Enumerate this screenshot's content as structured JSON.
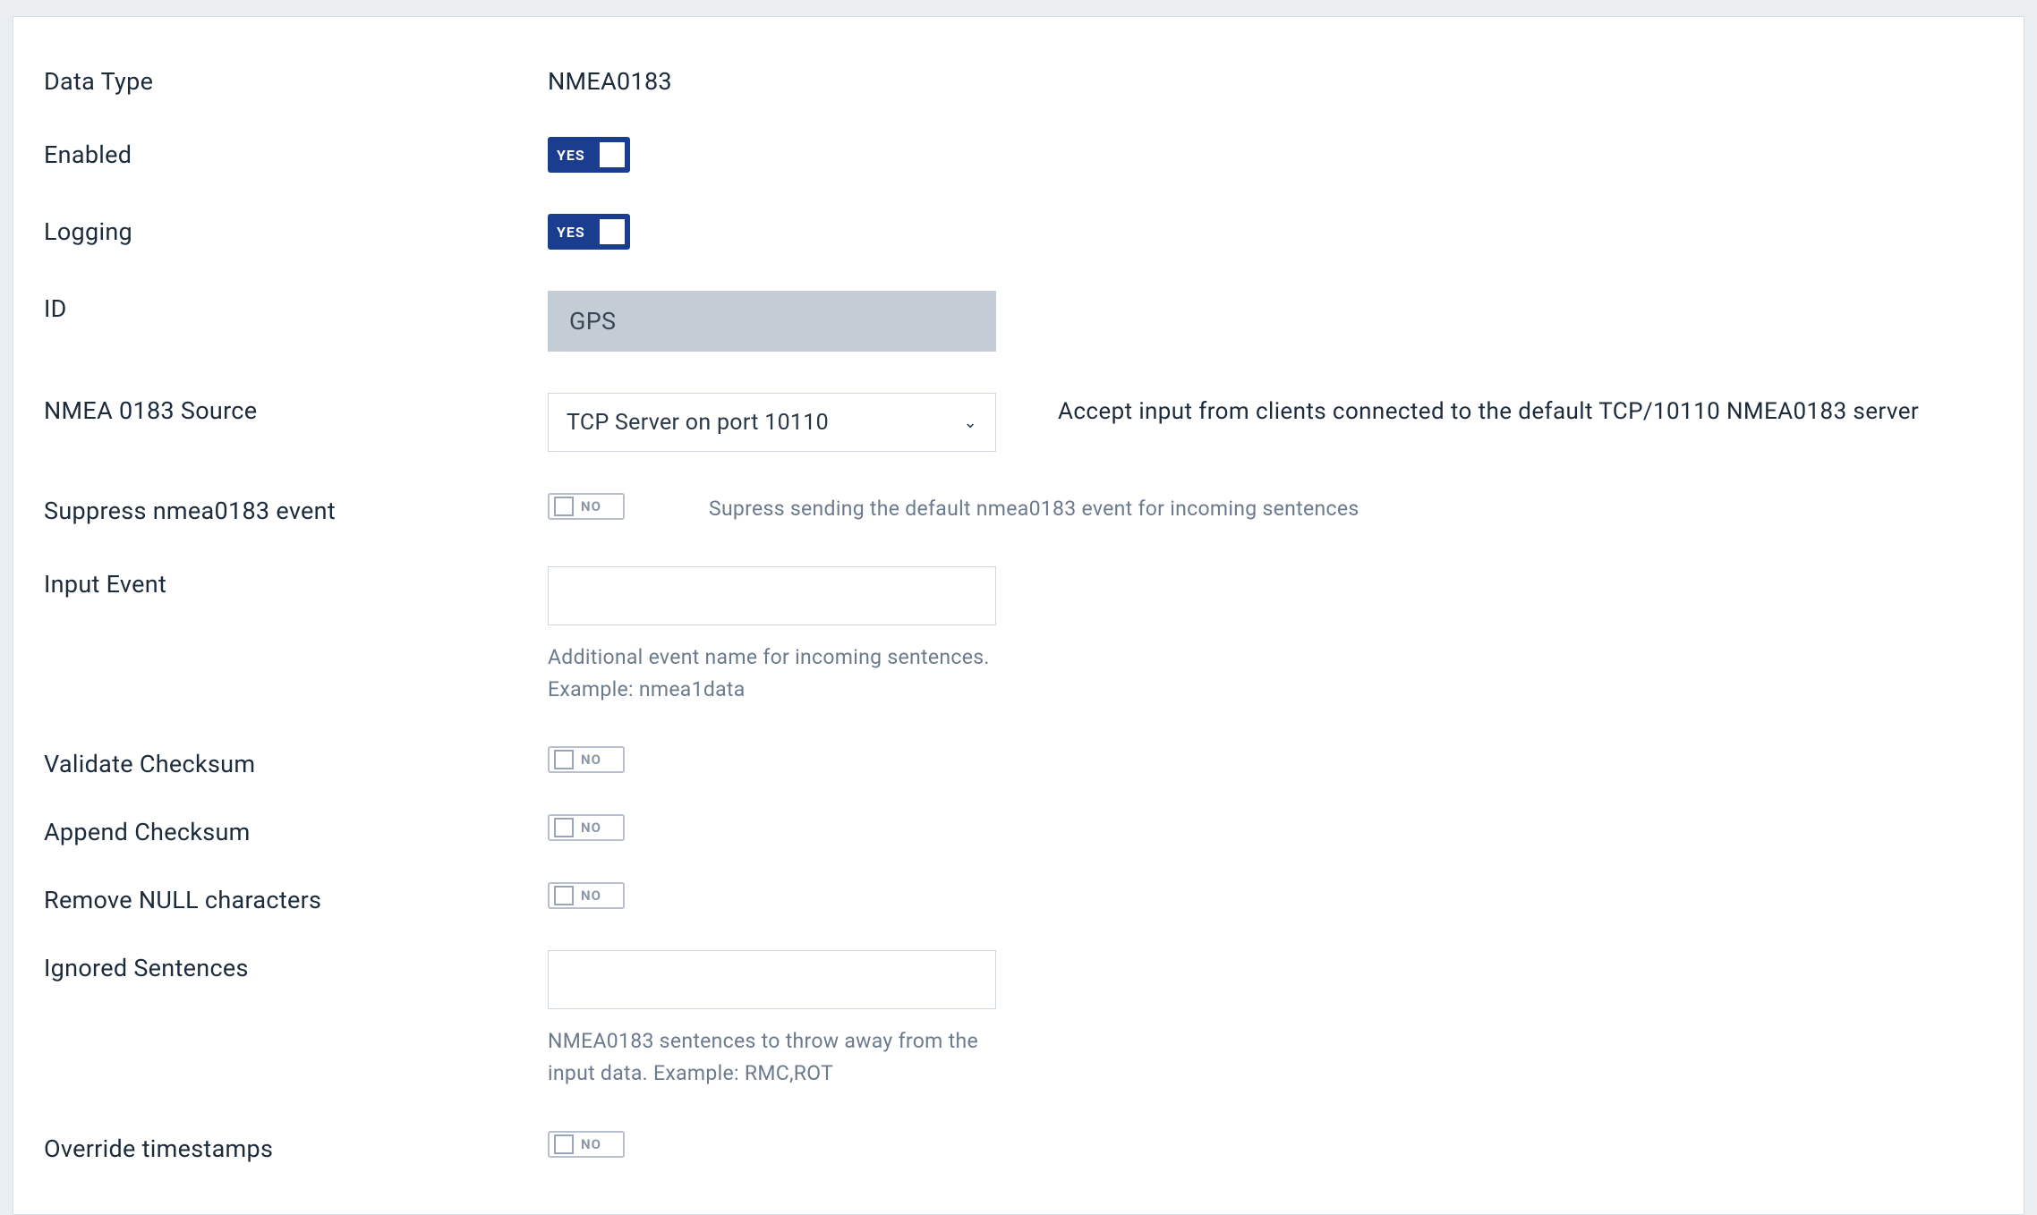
{
  "toggleLabels": {
    "yes": "YES",
    "no": "NO"
  },
  "rows": {
    "dataType": {
      "label": "Data Type",
      "value": "NMEA0183"
    },
    "enabled": {
      "label": "Enabled",
      "on": true
    },
    "logging": {
      "label": "Logging",
      "on": true
    },
    "id": {
      "label": "ID",
      "value": "GPS"
    },
    "source": {
      "label": "NMEA 0183 Source",
      "selected": "TCP Server on port 10110",
      "desc": "Accept input from clients connected to the default TCP/10110 NMEA0183 server"
    },
    "suppress": {
      "label": "Suppress nmea0183 event",
      "on": false,
      "desc": "Supress sending the default nmea0183 event for incoming sentences"
    },
    "inputEvent": {
      "label": "Input Event",
      "value": "",
      "help": "Additional event name for incoming sentences. Example: nmea1data"
    },
    "validateCk": {
      "label": "Validate Checksum",
      "on": false
    },
    "appendCk": {
      "label": "Append Checksum",
      "on": false
    },
    "removeNull": {
      "label": "Remove NULL characters",
      "on": false
    },
    "ignored": {
      "label": "Ignored Sentences",
      "value": "",
      "help": "NMEA0183 sentences to throw away from the input data. Example: RMC,ROT"
    },
    "overrideTs": {
      "label": "Override timestamps",
      "on": false
    }
  }
}
